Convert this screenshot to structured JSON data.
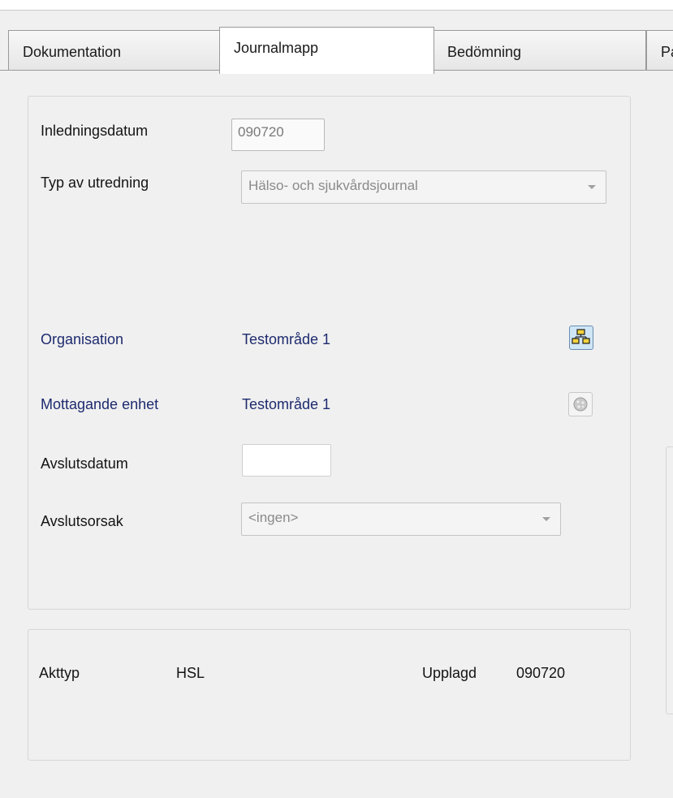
{
  "tabs": [
    {
      "label": "Dokumentation"
    },
    {
      "label": "Journalmapp"
    },
    {
      "label": "Bedömning"
    },
    {
      "label": "Pa"
    }
  ],
  "form": {
    "inledningsdatum_label": "Inledningsdatum",
    "inledningsdatum_value": "090720",
    "typ_label": "Typ av utredning",
    "typ_value": "Hälso- och sjukvårdsjournal",
    "organisation_label": "Organisation",
    "organisation_value": "Testområde 1",
    "mottagande_label": "Mottagande enhet",
    "mottagande_value": "Testområde 1",
    "avslutsdatum_label": "Avslutsdatum",
    "avslutsdatum_value": "",
    "avslutsorsak_label": "Avslutsorsak",
    "avslutsorsak_value": "<ingen>"
  },
  "footer": {
    "akttyp_label": "Akttyp",
    "akttyp_value": "HSL",
    "upplagd_label": "Upplagd",
    "upplagd_value": "090720"
  },
  "icons": {
    "organisation_button": "org-tree-icon",
    "mottagande_button": "unit-picker-icon"
  }
}
